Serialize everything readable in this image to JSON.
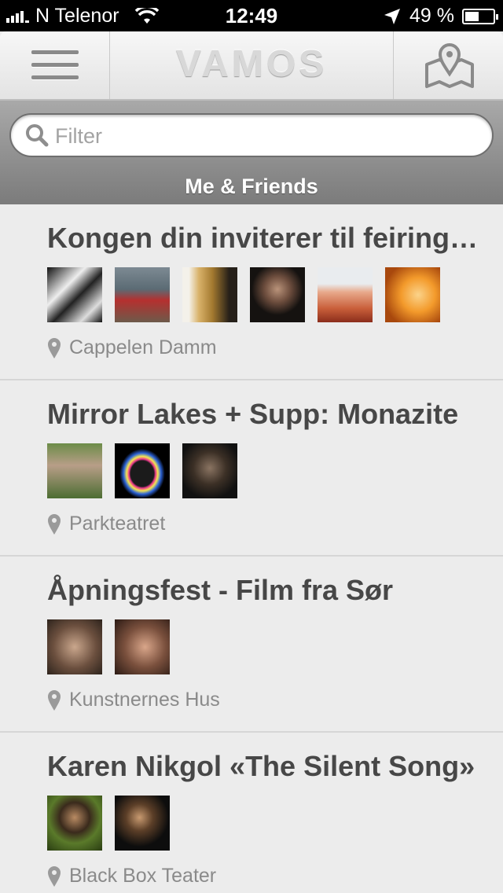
{
  "status_bar": {
    "carrier": "N Telenor",
    "time": "12:49",
    "battery": "49 %",
    "battery_level": 0.49
  },
  "nav": {
    "title": "VAMOS"
  },
  "search": {
    "placeholder": "Filter",
    "value": ""
  },
  "section": {
    "title": "Me & Friends"
  },
  "events": [
    {
      "title": "Kongen din inviterer til feiring med kakefest",
      "venue": "Cappelen Damm",
      "avatars": [
        {
          "bg": "linear-gradient(135deg,#111 0%,#eee 35%,#222 55%,#ddd 80%,#111 100%)"
        },
        {
          "bg": "linear-gradient(180deg,#7d8a93 0%,#5b6b74 40%,#b5302f 60%,#6d5a4a 100%)"
        },
        {
          "bg": "linear-gradient(90deg,#f4f1ea 0%,#f4f1ea 12%,#d9b26a 30%,#a3792f 55%,#262019 85%)"
        },
        {
          "bg": "radial-gradient(circle at 50% 40%,#b9937a 0%,#6e4e3e 30%,#151210 60%)"
        },
        {
          "bg": "linear-gradient(180deg,#e9ecef 0%,#e9ecef 30%,#e8a98c 45%,#c95f3a 75%,#8b2d1b 100%)"
        },
        {
          "bg": "radial-gradient(circle at 60% 50%,#fbd38a 0%,#f39a2b 40%,#a8480d 80%)"
        }
      ]
    },
    {
      "title": "Mirror Lakes + Supp: Monazite",
      "venue": "Parkteatret",
      "avatars": [
        {
          "bg": "linear-gradient(180deg,#6c8c48 0%,#b89e88 40%,#4c6d32 100%)"
        },
        {
          "bg": "radial-gradient(ellipse at 50% 55%,#1b1b1b 30%,#e8368b 34%,#f5e650 40%,#2c63d8 48%,#000 58%)"
        },
        {
          "bg": "radial-gradient(circle at 50% 45%,#8a7462 0%,#3c3026 40%,#111 75%)"
        }
      ]
    },
    {
      "title": "Åpningsfest - Film fra Sør",
      "venue": "Kunstnernes Hus",
      "avatars": [
        {
          "bg": "radial-gradient(circle at 50% 50%,#caa78d 0%,#6b4f3e 55%,#2d231c 100%)"
        },
        {
          "bg": "radial-gradient(circle at 55% 50%,#d9a68a 0%,#7a503d 50%,#2b1a14 100%)"
        }
      ]
    },
    {
      "title": "Karen Nikgol «The Silent Song»",
      "venue": "Black Box Teater",
      "avatars": [
        {
          "bg": "radial-gradient(circle at 50% 40%,#b98b63 0%,#3a2a1c 35%,#5a7a2a 60%,#2a3d12 100%)"
        },
        {
          "bg": "radial-gradient(circle at 45% 40%,#c89a70 0%,#5c3f28 30%,#0d0d0d 65%)"
        }
      ]
    }
  ]
}
